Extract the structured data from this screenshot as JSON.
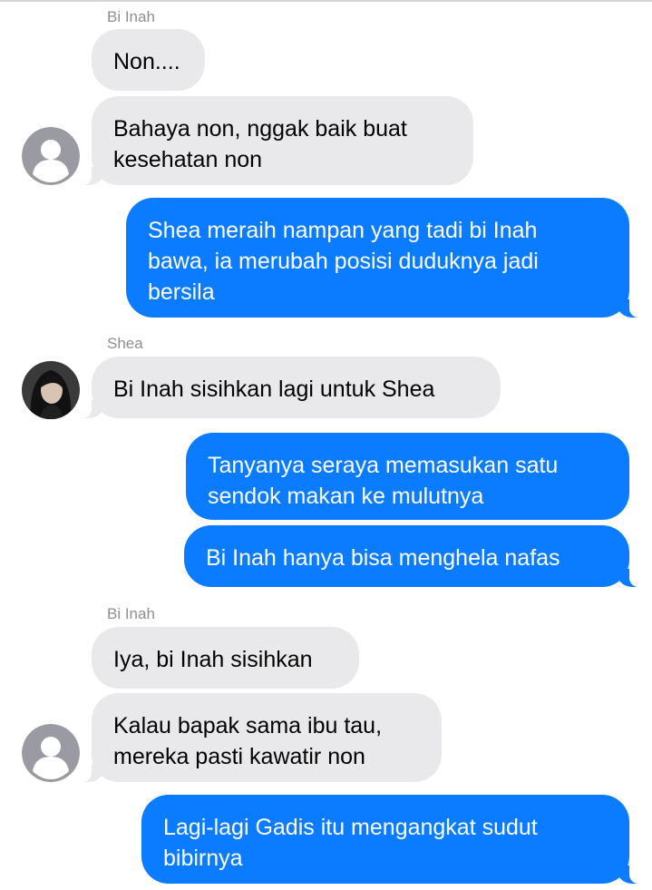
{
  "messages": [
    {
      "sender": "Bi Inah",
      "text_lines": [
        "Non...."
      ]
    },
    {
      "text_lines": [
        "Bahaya non, nggak baik buat",
        "kesehatan non"
      ]
    },
    {
      "text_lines": [
        "Shea meraih nampan yang tadi bi Inah",
        "bawa, ia merubah posisi duduknya jadi",
        "bersila"
      ]
    },
    {
      "sender": "Shea",
      "text_lines": [
        "Bi Inah sisihkan lagi untuk Shea"
      ]
    },
    {
      "text_lines": [
        "Tanyanya seraya memasukan satu",
        "sendok makan ke mulutnya"
      ]
    },
    {
      "text_lines": [
        "Bi Inah hanya bisa menghela nafas"
      ]
    },
    {
      "sender": "Bi Inah",
      "text_lines": [
        "Iya, bi Inah sisihkan"
      ]
    },
    {
      "text_lines": [
        "Kalau bapak sama ibu tau,",
        "mereka pasti kawatir non"
      ]
    },
    {
      "text_lines": [
        "Lagi-lagi Gadis itu mengangkat sudut",
        "bibirnya"
      ]
    }
  ],
  "colors": {
    "sent_bubble": "#0b7cff",
    "received_bubble": "#e9e9eb",
    "sender_label": "#8e8e93"
  },
  "icons": {
    "default_avatar": "person-icon",
    "shea_avatar": "photo-avatar"
  }
}
